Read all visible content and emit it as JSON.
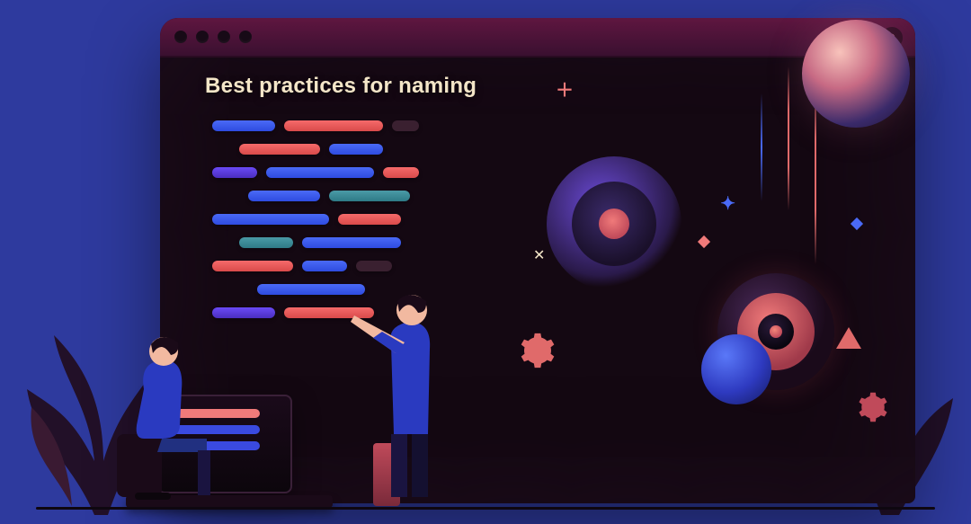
{
  "window": {
    "heading": "Best practices for naming"
  },
  "icons": {
    "search": "search-icon",
    "gear": "gear-icon",
    "plus": "plus-icon",
    "close": "close-icon"
  },
  "colors": {
    "background": "#2e3a9e",
    "window": "#140812",
    "titlebar": "#5f1640",
    "heading_text": "#f4e6c8",
    "accent_red": "#f07a7a",
    "accent_blue": "#3a4ae0",
    "planet_highlight": "#f8c3bb"
  }
}
